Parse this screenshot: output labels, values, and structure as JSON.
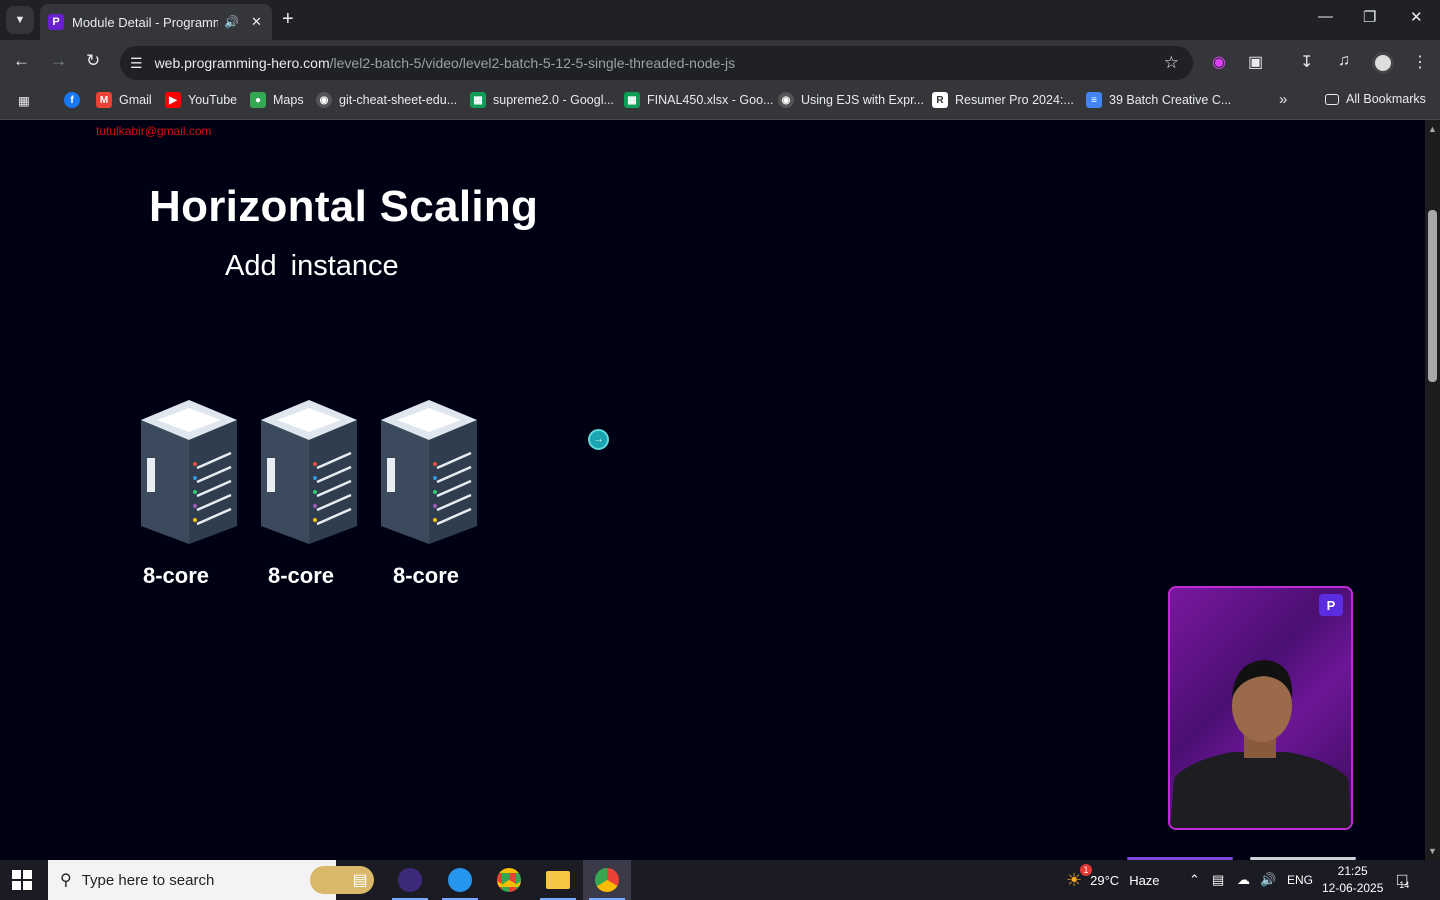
{
  "browser": {
    "tab_title": "Module Detail - Programmi",
    "address_prefix": "web.programming-hero.com",
    "address_path": "/level2-batch-5/video/level2-batch-5-12-5-single-threaded-node-js"
  },
  "bookmarks": [
    {
      "label": "",
      "icon": "facebook-icon",
      "color": "#1877f2"
    },
    {
      "label": "Gmail",
      "icon": "gmail-icon",
      "color": "#ea4335"
    },
    {
      "label": "YouTube",
      "icon": "youtube-icon",
      "color": "#ff0000"
    },
    {
      "label": "Maps",
      "icon": "maps-icon",
      "color": "#34a853"
    },
    {
      "label": "git-cheat-sheet-edu...",
      "icon": "github-icon",
      "color": "#24292e"
    },
    {
      "label": "supreme2.0 - Googl...",
      "icon": "sheets-icon",
      "color": "#0f9d58"
    },
    {
      "label": "FINAL450.xlsx - Goo...",
      "icon": "sheets-icon",
      "color": "#0f9d58"
    },
    {
      "label": "Using EJS with Expr...",
      "icon": "github-icon",
      "color": "#24292e"
    },
    {
      "label": "Resumer Pro 2024:...",
      "icon": "resumer-icon",
      "color": "#ffffff"
    },
    {
      "label": "39 Batch Creative C...",
      "icon": "docs-icon",
      "color": "#4285f4"
    }
  ],
  "all_bookmarks_label": "All Bookmarks",
  "video": {
    "watermark_email": "tutulkabir@gmail.com",
    "title": "Horizontal Scaling",
    "subtitle": "Add  instance",
    "servers": [
      {
        "label": "8-core"
      },
      {
        "label": "8-core"
      },
      {
        "label": "8-core"
      }
    ],
    "presenter_logo": "P"
  },
  "taskbar": {
    "search_placeholder": "Type here to search",
    "weather_temp": "29°C",
    "weather_text": "Haze",
    "weather_badge": "1",
    "language": "ENG",
    "time": "21:25",
    "date": "12-06-2025",
    "notification_count": "14"
  },
  "colors": {
    "page_bg": "#010114",
    "accent_purple": "#c02ad6",
    "watermark_red": "#d01010"
  }
}
